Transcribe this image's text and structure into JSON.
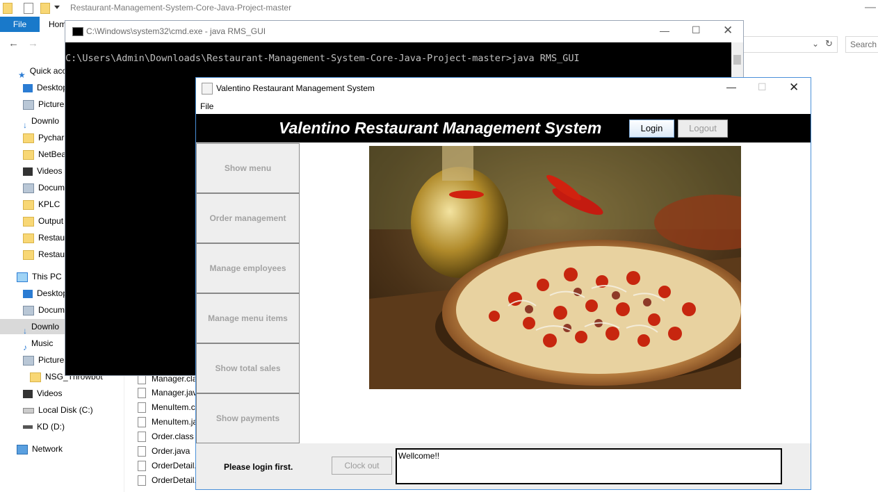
{
  "explorer": {
    "title": "Restaurant-Management-System-Core-Java-Project-master",
    "ribbon": {
      "file_tab": "File",
      "home_tab": "Hom"
    },
    "search_placeholder": "Search R",
    "nav": [
      {
        "label": "Quick acc",
        "icon": "star-icon"
      },
      {
        "label": "Desktop",
        "icon": "desktop-icon"
      },
      {
        "label": "Pictures",
        "icon": "pictures-icon"
      },
      {
        "label": "Downlo",
        "icon": "download-icon"
      },
      {
        "label": "Pycharm",
        "icon": "folder-icon"
      },
      {
        "label": "NetBean",
        "icon": "folder-icon"
      },
      {
        "label": "Videos",
        "icon": "videos-icon"
      },
      {
        "label": "Docum",
        "icon": "documents-icon"
      },
      {
        "label": "KPLC",
        "icon": "folder-icon"
      },
      {
        "label": "Output",
        "icon": "folder-icon"
      },
      {
        "label": "Restaur",
        "icon": "folder-icon"
      },
      {
        "label": "Restaur",
        "icon": "folder-icon"
      },
      {
        "label": "This PC",
        "icon": "pc-icon"
      },
      {
        "label": "Desktop",
        "icon": "desktop-icon"
      },
      {
        "label": "Docum",
        "icon": "documents-icon"
      },
      {
        "label": "Downlo",
        "icon": "download-icon"
      },
      {
        "label": "Music",
        "icon": "music-icon"
      },
      {
        "label": "Pictures",
        "icon": "pictures-icon"
      },
      {
        "label": "NSG_Throwbot",
        "icon": "folder-icon"
      },
      {
        "label": "Videos",
        "icon": "videos-icon"
      },
      {
        "label": "Local Disk (C:)",
        "icon": "disk-icon"
      },
      {
        "label": "KD (D:)",
        "icon": "drive-icon"
      },
      {
        "label": "Network",
        "icon": "network-icon"
      }
    ],
    "files": [
      "Manager.cla",
      "Manager.jav",
      "MenuItem.c",
      "MenuItem.ja",
      "Order.class",
      "Order.java",
      "OrderDetail.",
      "OrderDetail."
    ]
  },
  "cmd": {
    "title": "C:\\Windows\\system32\\cmd.exe - java  RMS_GUI",
    "line": "C:\\Users\\Admin\\Downloads\\Restaurant-Management-System-Core-Java-Project-master>java RMS_GUI"
  },
  "app": {
    "window_title": "Valentino Restaurant Management System",
    "menu_file": "File",
    "header_title": "Valentino Restaurant Management System",
    "login_label": "Login",
    "logout_label": "Logout",
    "side_buttons": [
      "Show menu",
      "Order management",
      "Manage employees",
      "Manage menu items",
      "Show total sales",
      "Show payments"
    ],
    "status_text": "Please login first.",
    "clockout_label": "Clock out",
    "message": "Wellcome!!"
  }
}
